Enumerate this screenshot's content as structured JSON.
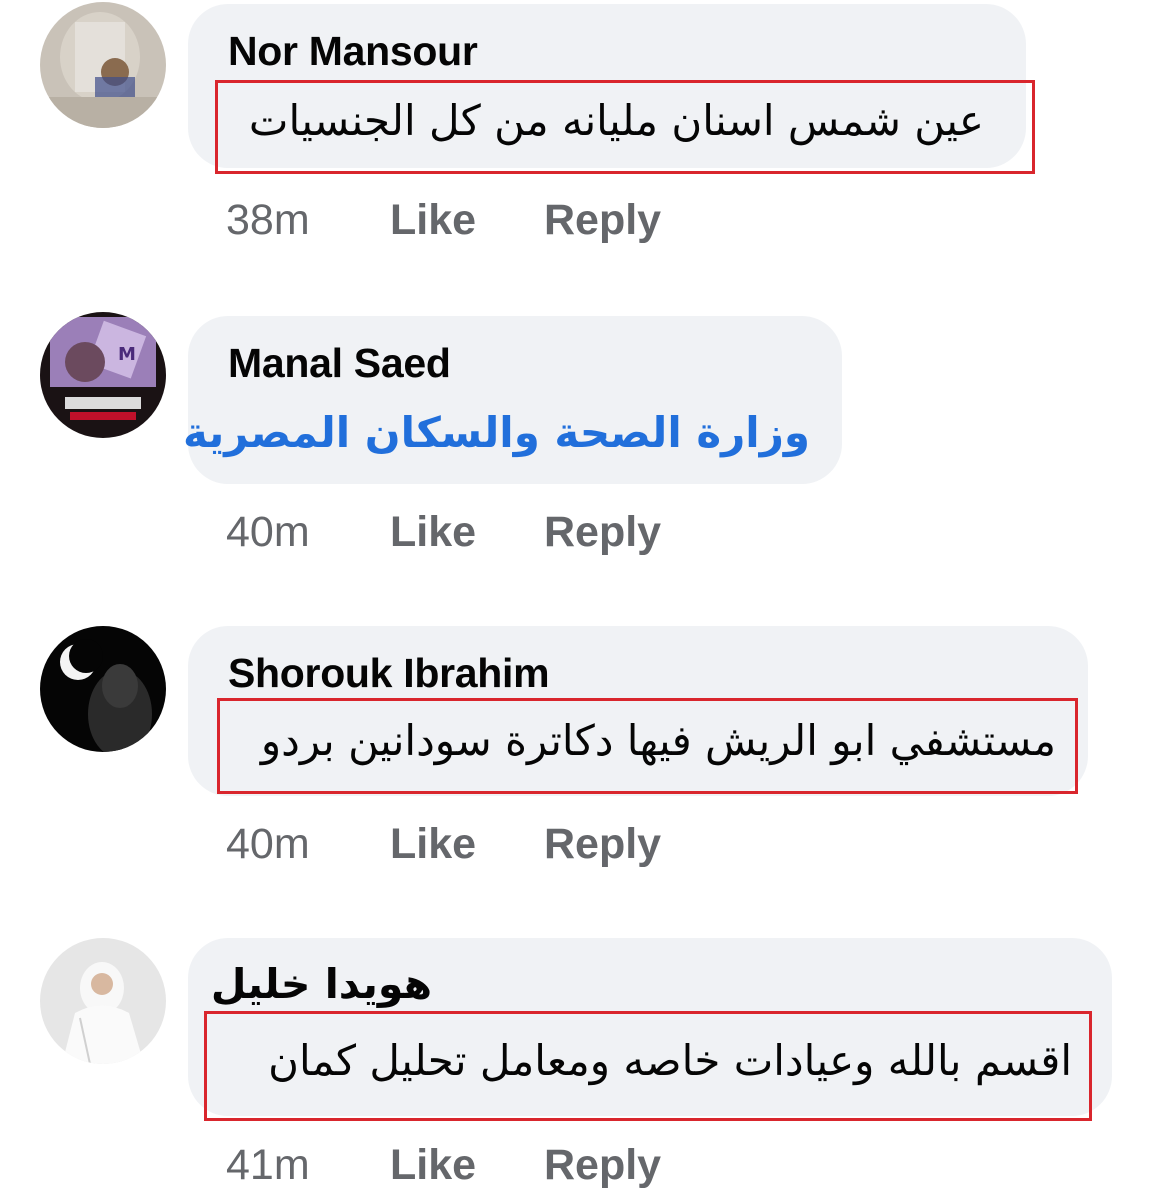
{
  "comments": [
    {
      "author": "Nor Mansour",
      "text": "عين شمس اسنان مليانه من كل الجنسيات",
      "time": "38m",
      "like_label": "Like",
      "reply_label": "Reply",
      "text_style": "normal",
      "highlighted": true
    },
    {
      "author": "Manal Saed",
      "text": "وزارة الصحة والسكان المصرية",
      "time": "40m",
      "like_label": "Like",
      "reply_label": "Reply",
      "text_style": "link",
      "highlighted": false
    },
    {
      "author": "Shorouk Ibrahim",
      "text": "مستشفي ابو الريش فيها دكاترة سودانين بردو",
      "time": "40m",
      "like_label": "Like",
      "reply_label": "Reply",
      "text_style": "normal",
      "highlighted": true
    },
    {
      "author": "هويدا خليل",
      "text": "اقسم بالله وعيادات خاصه ومعامل تحليل كمان",
      "time": "41m",
      "like_label": "Like",
      "reply_label": "Reply",
      "text_style": "normal",
      "highlighted": true
    }
  ],
  "colors": {
    "bubble": "#f0f2f5",
    "highlight_border": "#d9262d",
    "link_text": "#216fdb",
    "meta_text": "#65676b"
  }
}
